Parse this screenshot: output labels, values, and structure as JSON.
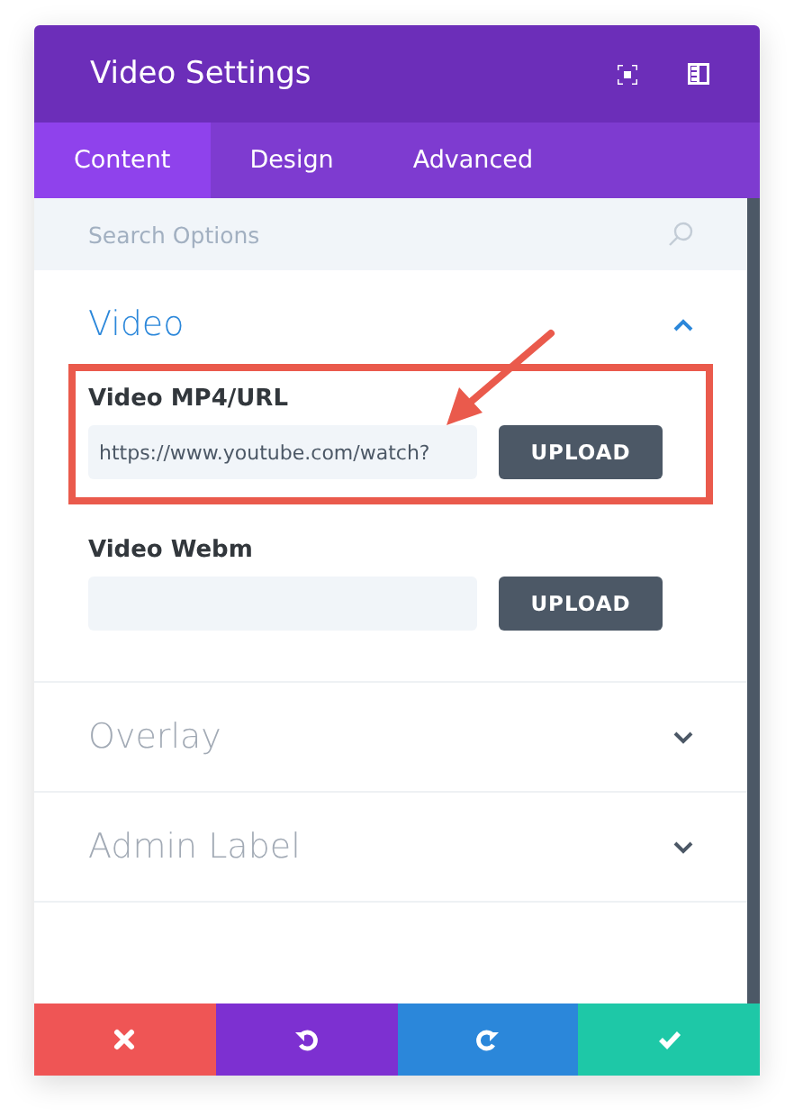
{
  "window": {
    "title": "Video Settings"
  },
  "tabs": [
    {
      "label": "Content",
      "selected": true
    },
    {
      "label": "Design",
      "selected": false
    },
    {
      "label": "Advanced",
      "selected": false
    }
  ],
  "search": {
    "placeholder": "Search Options"
  },
  "sections": [
    {
      "title": "Video",
      "expanded": true,
      "fields": [
        {
          "label": "Video MP4/URL",
          "value": "https://www.youtube.com/watch?",
          "button": "UPLOAD",
          "highlighted": true
        },
        {
          "label": "Video Webm",
          "button": "UPLOAD",
          "highlighted": false
        }
      ]
    },
    {
      "title": "Overlay",
      "expanded": false
    },
    {
      "title": "Admin Label",
      "expanded": false
    }
  ],
  "footer": [
    {
      "kind": "discard"
    },
    {
      "kind": "undo"
    },
    {
      "kind": "redo"
    },
    {
      "kind": "save"
    }
  ]
}
